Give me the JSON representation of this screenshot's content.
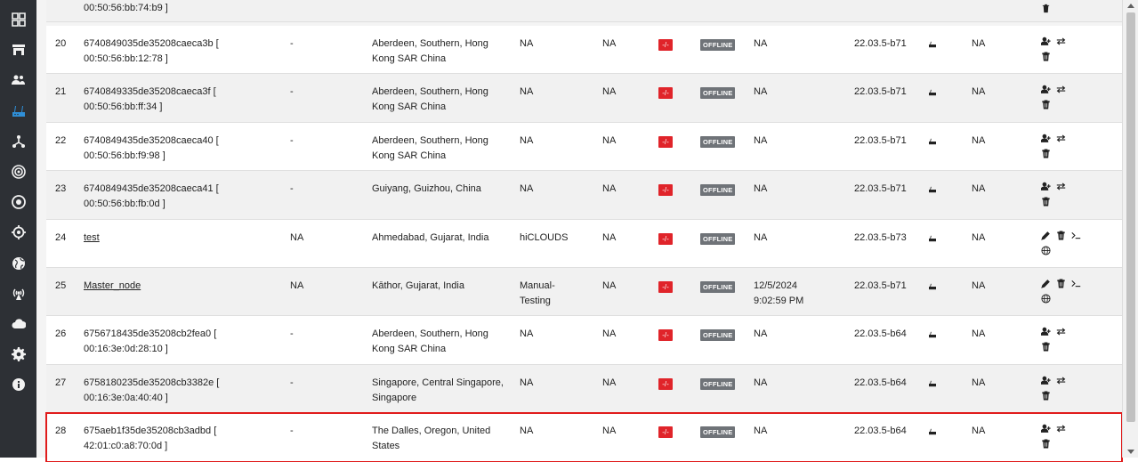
{
  "sidebar": {
    "items": [
      {
        "icon": "dashboard-grid-icon",
        "active": false
      },
      {
        "icon": "store-icon",
        "active": false
      },
      {
        "icon": "users-icon",
        "active": false
      },
      {
        "icon": "router-icon",
        "active": true
      },
      {
        "icon": "network-topology-icon",
        "active": false
      },
      {
        "icon": "radar-icon",
        "active": false
      },
      {
        "icon": "target-icon",
        "active": false
      },
      {
        "icon": "crosshair-icon",
        "active": false
      },
      {
        "icon": "globe-icon",
        "active": false
      },
      {
        "icon": "antenna-icon",
        "active": false
      },
      {
        "icon": "cloud-icon",
        "active": false
      },
      {
        "icon": "gear-icon",
        "active": false
      },
      {
        "icon": "info-icon",
        "active": false
      }
    ],
    "active_color": "#2f8fd8"
  },
  "top_partial": {
    "id_tail": "00:50:56:bb:74:b9 ]"
  },
  "rows": [
    {
      "idx": "20",
      "id_line1": "6740849035de35208caeca3b [",
      "id_line2": "00:50:56:bb:12:78 ]",
      "col2": "-",
      "loc_line1": "Aberdeen, Southern, Hong",
      "loc_line2": "Kong SAR China",
      "col4_line1": "NA",
      "col4_line2": "",
      "col5": "NA",
      "badge": "-/-",
      "status": "OFFLINE",
      "last_line1": "NA",
      "last_line2": "",
      "ver": "22.03.5-b71",
      "col_na3": "NA",
      "actions": "add-user"
    },
    {
      "idx": "21",
      "id_line1": "6740849335de35208caeca3f [",
      "id_line2": "00:50:56:bb:ff:34 ]",
      "col2": "-",
      "loc_line1": "Aberdeen, Southern, Hong",
      "loc_line2": "Kong SAR China",
      "col4_line1": "NA",
      "col4_line2": "",
      "col5": "NA",
      "badge": "-/-",
      "status": "OFFLINE",
      "last_line1": "NA",
      "last_line2": "",
      "ver": "22.03.5-b71",
      "col_na3": "NA",
      "actions": "add-user"
    },
    {
      "idx": "22",
      "id_line1": "6740849435de35208caeca40 [",
      "id_line2": "00:50:56:bb:f9:98 ]",
      "col2": "-",
      "loc_line1": "Aberdeen, Southern, Hong",
      "loc_line2": "Kong SAR China",
      "col4_line1": "NA",
      "col4_line2": "",
      "col5": "NA",
      "badge": "-/-",
      "status": "OFFLINE",
      "last_line1": "NA",
      "last_line2": "",
      "ver": "22.03.5-b71",
      "col_na3": "NA",
      "actions": "add-user"
    },
    {
      "idx": "23",
      "id_line1": "6740849435de35208caeca41 [",
      "id_line2": "00:50:56:bb:fb:0d ]",
      "col2": "-",
      "loc_line1": "Guiyang, Guizhou, China",
      "loc_line2": "",
      "col4_line1": "NA",
      "col4_line2": "",
      "col5": "NA",
      "badge": "-/-",
      "status": "OFFLINE",
      "last_line1": "NA",
      "last_line2": "",
      "ver": "22.03.5-b71",
      "col_na3": "NA",
      "actions": "add-user"
    },
    {
      "idx": "24",
      "id_line1": "test",
      "id_line2": "",
      "col2": "NA",
      "loc_line1": "Ahmedabad, Gujarat, India",
      "loc_line2": "",
      "col4_line1": "hiCLOUDS",
      "col4_line2": "",
      "col5": "NA",
      "badge": "-/-",
      "status": "OFFLINE",
      "last_line1": "NA",
      "last_line2": "",
      "ver": "22.03.5-b73",
      "col_na3": "NA",
      "actions": "edit"
    },
    {
      "idx": "25",
      "id_line1": "Master_node",
      "id_line2": "",
      "col2": "NA",
      "loc_line1": "Kāthor, Gujarat, India",
      "loc_line2": "",
      "col4_line1": "Manual-",
      "col4_line2": "Testing",
      "col5": "NA",
      "badge": "-/-",
      "status": "OFFLINE",
      "last_line1": "12/5/2024",
      "last_line2": "9:02:59 PM",
      "ver": "22.03.5-b71",
      "col_na3": "NA",
      "actions": "edit"
    },
    {
      "idx": "26",
      "id_line1": "6756718435de35208cb2fea0 [",
      "id_line2": "00:16:3e:0d:28:10 ]",
      "col2": "-",
      "loc_line1": "Aberdeen, Southern, Hong",
      "loc_line2": "Kong SAR China",
      "col4_line1": "NA",
      "col4_line2": "",
      "col5": "NA",
      "badge": "-/-",
      "status": "OFFLINE",
      "last_line1": "NA",
      "last_line2": "",
      "ver": "22.03.5-b64",
      "col_na3": "NA",
      "actions": "add-user"
    },
    {
      "idx": "27",
      "id_line1": "6758180235de35208cb3382e [",
      "id_line2": "00:16:3e:0a:40:40 ]",
      "col2": "-",
      "loc_line1": "Singapore, Central Singapore,",
      "loc_line2": "Singapore",
      "col4_line1": "NA",
      "col4_line2": "",
      "col5": "NA",
      "badge": "-/-",
      "status": "OFFLINE",
      "last_line1": "NA",
      "last_line2": "",
      "ver": "22.03.5-b64",
      "col_na3": "NA",
      "actions": "add-user"
    },
    {
      "idx": "28",
      "id_line1": "675aeb1f35de35208cb3adbd [",
      "id_line2": "42:01:c0:a8:70:0d ]",
      "col2": "-",
      "loc_line1": "The Dalles, Oregon, United",
      "loc_line2": "States",
      "col4_line1": "NA",
      "col4_line2": "",
      "col5": "NA",
      "badge": "-/-",
      "status": "OFFLINE",
      "last_line1": "NA",
      "last_line2": "",
      "ver": "22.03.5-b64",
      "col_na3": "NA",
      "actions": "add-user"
    }
  ],
  "colors": {
    "offline_badge": "#6f7378",
    "red_badge": "#e0242a",
    "highlight_outline": "#e01b1b"
  }
}
